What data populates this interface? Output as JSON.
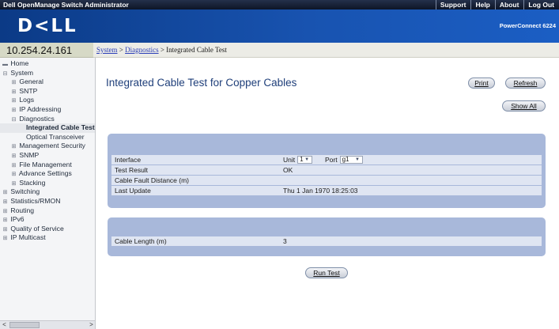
{
  "topbar": {
    "title": "Dell OpenManage Switch Administrator",
    "links": [
      "Support",
      "Help",
      "About",
      "Log Out"
    ]
  },
  "banner": {
    "logo": "D<LL",
    "model": "PowerConnect 6224"
  },
  "address": {
    "ip": "10.254.24.161"
  },
  "breadcrumb": {
    "items": [
      "System",
      "Diagnostics"
    ],
    "separator": ">",
    "current": "Integrated Cable Test"
  },
  "sidebar": {
    "items": [
      {
        "label": "Home",
        "glyph": "▬"
      },
      {
        "label": "System",
        "glyph": "⊟"
      },
      {
        "label": "General",
        "glyph": "⊞"
      },
      {
        "label": "SNTP",
        "glyph": "⊞"
      },
      {
        "label": "Logs",
        "glyph": "⊞"
      },
      {
        "label": "IP Addressing",
        "glyph": "⊞"
      },
      {
        "label": "Diagnostics",
        "glyph": "⊟"
      },
      {
        "label": "Integrated Cable Test",
        "glyph": ""
      },
      {
        "label": "Optical Transceiver",
        "glyph": ""
      },
      {
        "label": "Management Security",
        "glyph": "⊞"
      },
      {
        "label": "SNMP",
        "glyph": "⊞"
      },
      {
        "label": "File Management",
        "glyph": "⊞"
      },
      {
        "label": "Advance Settings",
        "glyph": "⊞"
      },
      {
        "label": "Stacking",
        "glyph": "⊞"
      },
      {
        "label": "Switching",
        "glyph": "⊞"
      },
      {
        "label": "Statistics/RMON",
        "glyph": "⊞"
      },
      {
        "label": "Routing",
        "glyph": "⊞"
      },
      {
        "label": "IPv6",
        "glyph": "⊞"
      },
      {
        "label": "Quality of Service",
        "glyph": "⊞"
      },
      {
        "label": "IP Multicast",
        "glyph": "⊞"
      }
    ],
    "scroll_left": "<",
    "scroll_right": ">"
  },
  "main": {
    "title": "Integrated Cable Test for Copper Cables",
    "print_label": "Print",
    "refresh_label": "Refresh",
    "show_all_label": "Show All",
    "run_test_label": "Run Test"
  },
  "test": {
    "interface_label": "Interface",
    "unit_label": "Unit",
    "unit_value": "1",
    "port_label": "Port",
    "port_value": "g1",
    "result_label": "Test Result",
    "result_value": "OK",
    "fault_label": "Cable Fault Distance (m)",
    "fault_value": "",
    "update_label": "Last Update",
    "update_value": "Thu 1 Jan 1970 18:25:03",
    "length_label": "Cable Length (m)",
    "length_value": "3"
  },
  "colors": {
    "banner": "#1853b0",
    "panel": "#a8b8da",
    "row": "#dfe5f2",
    "title": "#1f3f7a"
  }
}
